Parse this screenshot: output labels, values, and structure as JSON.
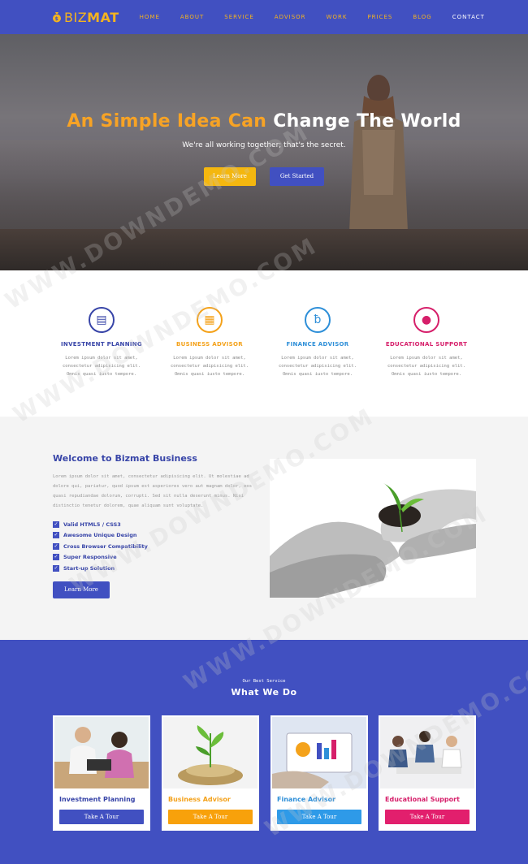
{
  "nav": {
    "logo_biz": "BIZ",
    "logo_mat": "MAT",
    "items": [
      {
        "label": "HOME"
      },
      {
        "label": "ABOUT"
      },
      {
        "label": "SERVICE"
      },
      {
        "label": "ADVISOR"
      },
      {
        "label": "WORK"
      },
      {
        "label": "PRICES"
      },
      {
        "label": "BLOG"
      },
      {
        "label": "CONTACT"
      }
    ]
  },
  "hero": {
    "title_part1": "An Simple Idea Can",
    "title_part2": "Change The World",
    "subtitle": "We're all working together; that's the secret.",
    "btn_learn": "Learn More",
    "btn_start": "Get Started"
  },
  "features": [
    {
      "title": "INVESTMENT PLANNING",
      "color": "#3845a8",
      "icon": "money-icon",
      "text": [
        "Lorem ipsum dolor sit amet,",
        "consectetur adipisicing elit.",
        "Omnis quasi iusto tempore."
      ]
    },
    {
      "title": "BUSINESS ADVISOR",
      "color": "#f4a21b",
      "icon": "chart-icon",
      "text": [
        "Lorem ipsum dolor sit amet,",
        "consectetur adipisicing elit.",
        "Omnis quasi iusto tempore."
      ]
    },
    {
      "title": "FINANCE ADVISOR",
      "color": "#2e8fd8",
      "icon": "finance-icon",
      "text": [
        "Lorem ipsum dolor sit amet,",
        "consectetur adipisicing elit.",
        "Omnis quasi iusto tempore."
      ]
    },
    {
      "title": "EDUCATIONAL SUPPORT",
      "color": "#d61f6a",
      "icon": "support-icon",
      "text": [
        "Lorem ipsum dolor sit amet,",
        "consectetur adipisicing elit.",
        "Omnis quasi iusto tempore."
      ]
    }
  ],
  "welcome": {
    "title": "Welcome to Bizmat Business",
    "text": "Lorem ipsum dolor sit amet, consectetur adipisicing elit. Ut molestiae ad dolore qui, pariatur, quod ipsum est asperiores vero aut magnam dolor, eos quasi repudiandae dolorum, corrupti. Sed sit nulla deserunt minus. Nisi distinctio tenetur dolorem, quae aliquam sunt voluptate.",
    "checklist": [
      "Valid HTML5 / CSS3",
      "Awesome Unique Design",
      "Cross Browser Compatibility",
      "Super Responsive",
      "Start-up Solution"
    ],
    "button": "Learn More"
  },
  "services": {
    "small_title": "Our Best Service",
    "title": "What We Do",
    "cards": [
      {
        "title": "Investment Planning",
        "title_color": "#3845a8",
        "btn_color": "#4150c1",
        "button": "Take A Tour"
      },
      {
        "title": "Business Advisor",
        "title_color": "#f4a21b",
        "btn_color": "#f8a10b",
        "button": "Take A Tour"
      },
      {
        "title": "Finance Advisor",
        "title_color": "#2e8fd8",
        "btn_color": "#2e9ae8",
        "button": "Take A Tour"
      },
      {
        "title": "Educational Support",
        "title_color": "#d61f6a",
        "btn_color": "#e21f6d",
        "button": "Take A Tour"
      }
    ]
  },
  "watermark": "WWW.DOWNDEMO.COM"
}
